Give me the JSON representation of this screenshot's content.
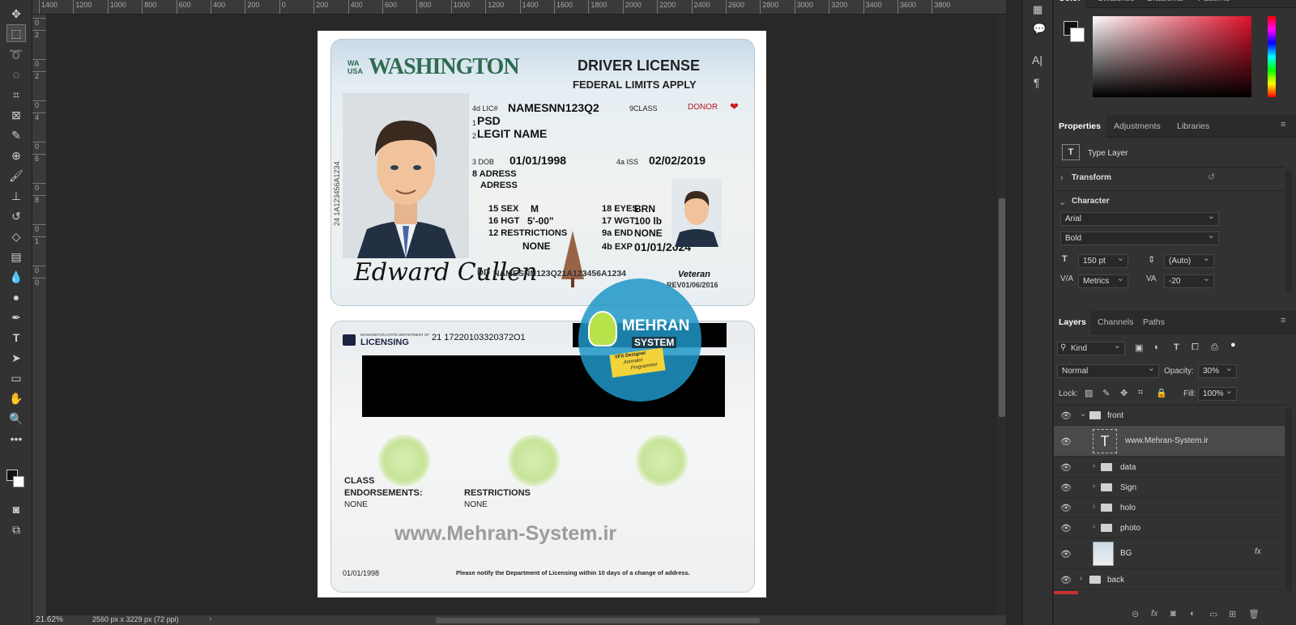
{
  "status": {
    "zoom": "21.62%",
    "doc_info": "2560 px x 3229 px (72 ppi)"
  },
  "ruler_top": [
    "1400",
    "1200",
    "1000",
    "800",
    "600",
    "400",
    "200",
    "0",
    "200",
    "400",
    "600",
    "800",
    "1000",
    "1200",
    "1400",
    "1600",
    "1800",
    "2000",
    "2200",
    "2400",
    "2600",
    "2800",
    "3000",
    "3200",
    "3400",
    "3600",
    "3800"
  ],
  "ruler_left": [
    "0",
    "2",
    "0",
    "2",
    "0",
    "4",
    "0",
    "6",
    "0",
    "8",
    "0",
    "1",
    "0",
    "0"
  ],
  "front": {
    "state_abbr": "WA",
    "country": "USA",
    "state": "WASHINGTON",
    "doc_title": "DRIVER LICENSE",
    "subtitle": "FEDERAL LIMITS APPLY",
    "lic_label": "4d LIC#",
    "lic_no": "NAMESNN123Q2",
    "class_label": "9CLASS",
    "donor": "DONOR",
    "last_num": "1",
    "last_name": "PSD",
    "first_num": "2",
    "first_name": "LEGIT NAME",
    "dob_label": "3 DOB",
    "dob": "01/01/1998",
    "iss_label": "4a ISS",
    "iss": "02/02/2019",
    "addr_label": "8 ADRESS",
    "addr2": "ADRESS",
    "vertical_no": "24 1A123456A1234",
    "sex_label": "15 SEX",
    "sex": "M",
    "eyes_label": "18 EYES",
    "eyes": "BRN",
    "hgt_label": "16 HGT",
    "hgt": "5'-00\"",
    "wgt_label": "17 WGT",
    "wgt": "100 lb",
    "restr_label": "12 RESTRICTIONS",
    "restr": "NONE",
    "end_label": "9a END",
    "end": "NONE",
    "exp_label": "4b EXP",
    "exp": "01/01/2024",
    "dd_label": "DD",
    "dd": "NAMESNN123Q21A123456A1234",
    "veteran": "Veteran",
    "rev": "REV01/06/2016",
    "signature": "Edward Cullen"
  },
  "back": {
    "dept_small": "WASHINGTON STATE DEPARTMENT OF",
    "licensing": "LICENSING",
    "code": "21 17220103320372O1",
    "class_label": "CLASS",
    "endorse_label": "ENDORSEMENTS:",
    "endorse_val": "NONE",
    "restr_label": "RESTRICTIONS",
    "restr_val": "NONE",
    "watermark": "www.Mehran-System.ir",
    "date": "01/01/1998",
    "notice": "Please notify the Department of Licensing within 10 days of a change of address."
  },
  "logo": {
    "line1": "MEHRAN",
    "line2": "SYSTEM",
    "tag1": "VFX Designer",
    "tag2": "Animator",
    "tag3": "Programmer"
  },
  "panel": {
    "color_tabs": [
      "Color",
      "Swatches",
      "Gradients",
      "Patterns"
    ],
    "prop_tabs": [
      "Properties",
      "Adjustments",
      "Libraries"
    ],
    "type_layer": "Type Layer",
    "transform": "Transform",
    "character": "Character",
    "font_family": "Arial",
    "font_style": "Bold",
    "font_size": "150 pt",
    "leading": "(Auto)",
    "kerning": "Metrics",
    "tracking": "-20",
    "layer_tabs": [
      "Layers",
      "Channels",
      "Paths"
    ],
    "filter": "Kind",
    "blend_mode": "Normal",
    "opacity_label": "Opacity:",
    "opacity": "30%",
    "lock_label": "Lock:",
    "fill_label": "Fill:",
    "fill": "100%",
    "layers": [
      "front",
      "www.Mehran-System.ir",
      "data",
      "Sign",
      "holo",
      "photo",
      "BG",
      "back"
    ]
  },
  "colors": {
    "accent_green": "#2e6b4f",
    "hue_red": "#e0102a"
  }
}
